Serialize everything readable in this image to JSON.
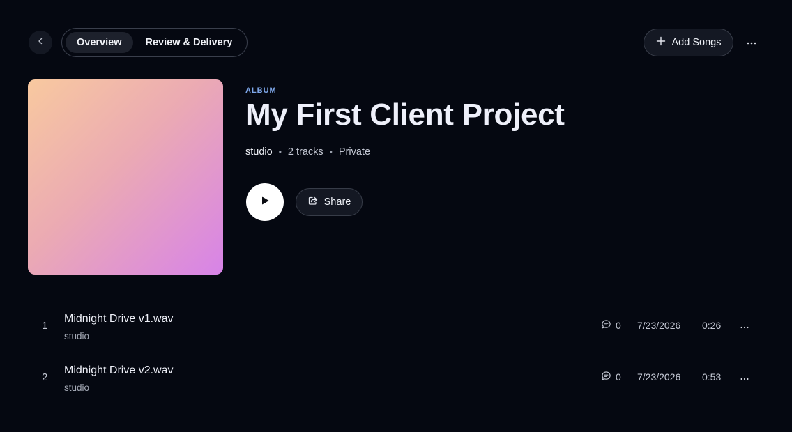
{
  "nav": {
    "tabs": [
      {
        "label": "Overview",
        "active": true
      },
      {
        "label": "Review & Delivery",
        "active": false
      }
    ],
    "add_songs_label": "Add Songs"
  },
  "project": {
    "kind": "ALBUM",
    "title": "My First Client Project",
    "owner": "studio",
    "track_count": "2 tracks",
    "visibility": "Private",
    "share_label": "Share"
  },
  "tracks": [
    {
      "number": "1",
      "name": "Midnight Drive v1.wav",
      "artist": "studio",
      "comments": "0",
      "date": "7/23/2026",
      "duration": "0:26"
    },
    {
      "number": "2",
      "name": "Midnight Drive v2.wav",
      "artist": "studio",
      "comments": "0",
      "date": "7/23/2026",
      "duration": "0:53"
    }
  ],
  "icons": {
    "back": "chevron-left-icon",
    "add": "plus-icon",
    "more": "more-horizontal-icon",
    "play": "play-icon",
    "share": "share-icon",
    "comment": "comment-icon"
  },
  "colors": {
    "background": "#050811",
    "accent_label": "#7ea7ea",
    "cover_gradient_start": "#f8c99f",
    "cover_gradient_end": "#d783e8"
  }
}
